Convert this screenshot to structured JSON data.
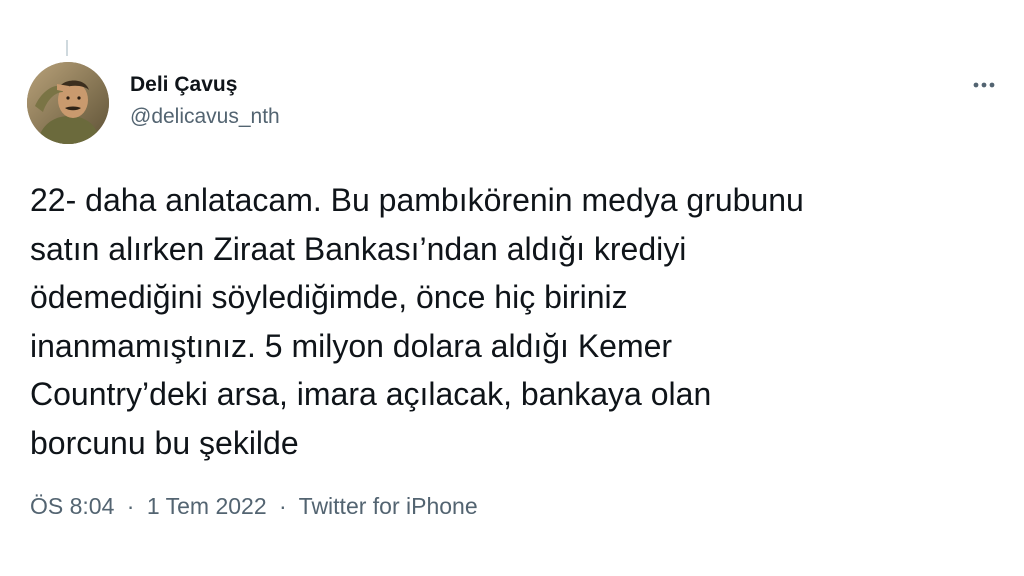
{
  "tweet": {
    "author": {
      "display_name": "Deli Çavuş",
      "handle": "@delicavus_nth"
    },
    "text": "22- daha anlatacam. Bu pambıkörenin medya grubunu\nsatın alırken Ziraat Bankası’ndan aldığı krediyi\nödemediğini söylediğimde, önce hiç biriniz\ninanmamıştınız. 5 milyon dolara aldığı Kemer\nCountry’deki arsa, imara açılacak, bankaya olan\nborcunu bu şekilde",
    "time": "ÖS 8:04",
    "date": "1 Tem 2022",
    "source": "Twitter for iPhone",
    "separator": "·",
    "more_icon": "more-horizontal-icon"
  },
  "colors": {
    "text_primary": "#0f1419",
    "text_secondary": "#536471",
    "background": "#ffffff",
    "thread_line": "#cfd9de"
  }
}
